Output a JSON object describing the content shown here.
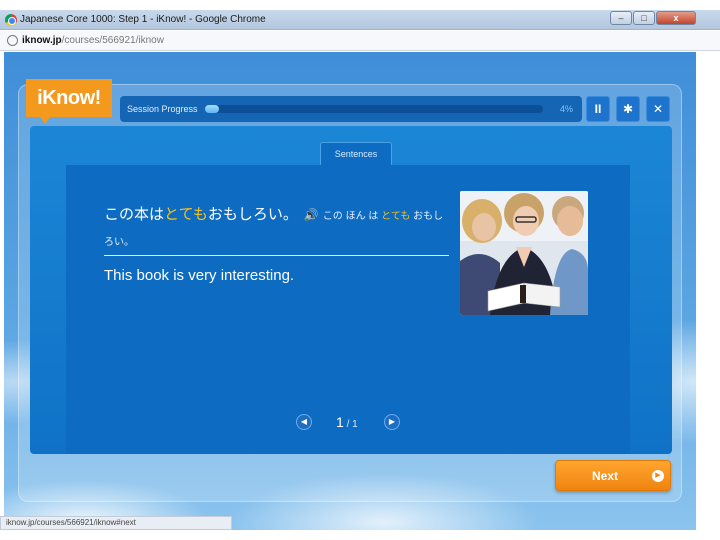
{
  "window": {
    "title": "Japanese Core 1000: Step 1 - iKnow! - Google Chrome",
    "minimize_label": "–",
    "maximize_label": "□",
    "close_label": "x"
  },
  "address_bar": {
    "host": "iknow.jp",
    "path": "/courses/566921/iknow"
  },
  "app": {
    "logo_text": "iKnow!",
    "session": {
      "label": "Session Progress",
      "percent_text": "4%",
      "progress_fraction": 0.04
    },
    "controls": {
      "pause_icon": "II",
      "settings_icon": "✱",
      "close_icon": "✕"
    },
    "tab_label": "Sentences",
    "sentence": {
      "jp_before": "この本は",
      "jp_highlight": "とても",
      "jp_after": "おもしろい。",
      "speaker_icon": "🔊",
      "reading_before": "この ほん は ",
      "reading_highlight": "とても",
      "reading_after": " おもしろい。",
      "english": "This book is very interesting."
    },
    "pager": {
      "prev_icon": "◀",
      "current": "1",
      "total": " / 1",
      "next_icon": "▶"
    },
    "next_button": {
      "label": "Next",
      "arrow_icon": "▶"
    }
  },
  "status_bar": {
    "text": "iknow.jp/courses/566921/iknow#next"
  },
  "colors": {
    "accent_orange": "#f39a1e",
    "highlight_yellow": "#f7c21c",
    "panel_blue": "#0d6bc1"
  }
}
